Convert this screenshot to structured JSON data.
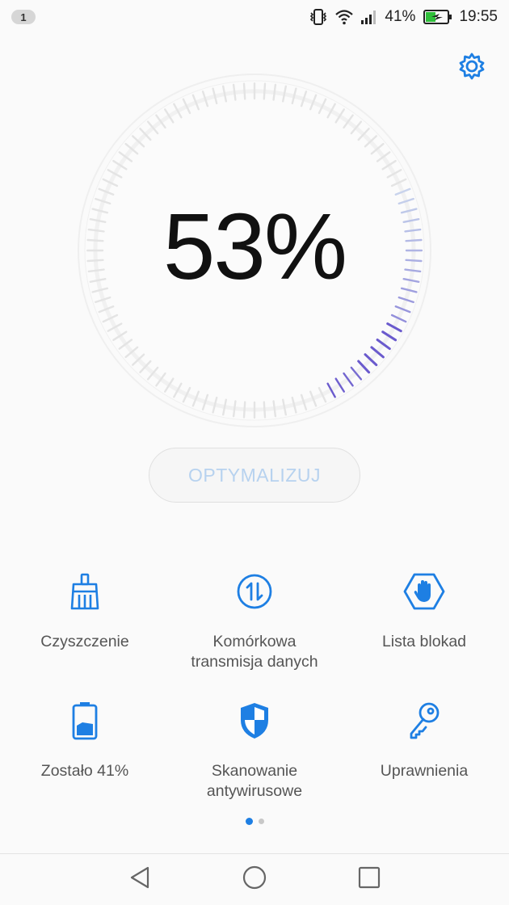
{
  "status_bar": {
    "notification_count": "1",
    "battery_percent": "41%",
    "time": "19:55",
    "icons": [
      "vibrate-icon",
      "wifi-icon",
      "signal-icon",
      "battery-charging-icon"
    ]
  },
  "settings": {
    "icon": "gear-icon"
  },
  "gauge": {
    "value_text": "53%",
    "value": 53,
    "accent_color": "#6a5acd",
    "track_color": "#e4e4e4"
  },
  "optimize_button": {
    "label": "OPTYMALIZUJ",
    "enabled": false
  },
  "tiles": [
    {
      "label": "Czyszczenie",
      "icon": "broom-icon"
    },
    {
      "label": "Komórkowa\ntransmisja danych",
      "icon": "data-transfer-icon"
    },
    {
      "label": "Lista blokad",
      "icon": "block-hand-icon"
    },
    {
      "label": "Zostało 41%",
      "icon": "battery-icon"
    },
    {
      "label": "Skanowanie\nantywirusowe",
      "icon": "shield-icon"
    },
    {
      "label": "Uprawnienia",
      "icon": "key-icon"
    }
  ],
  "pagination": {
    "current": 1,
    "total": 2
  },
  "colors": {
    "accent": "#1e7fe3",
    "button_text_disabled": "#b7d2ef"
  },
  "nav": {
    "icons": [
      "back-icon",
      "home-icon",
      "recents-icon"
    ]
  }
}
